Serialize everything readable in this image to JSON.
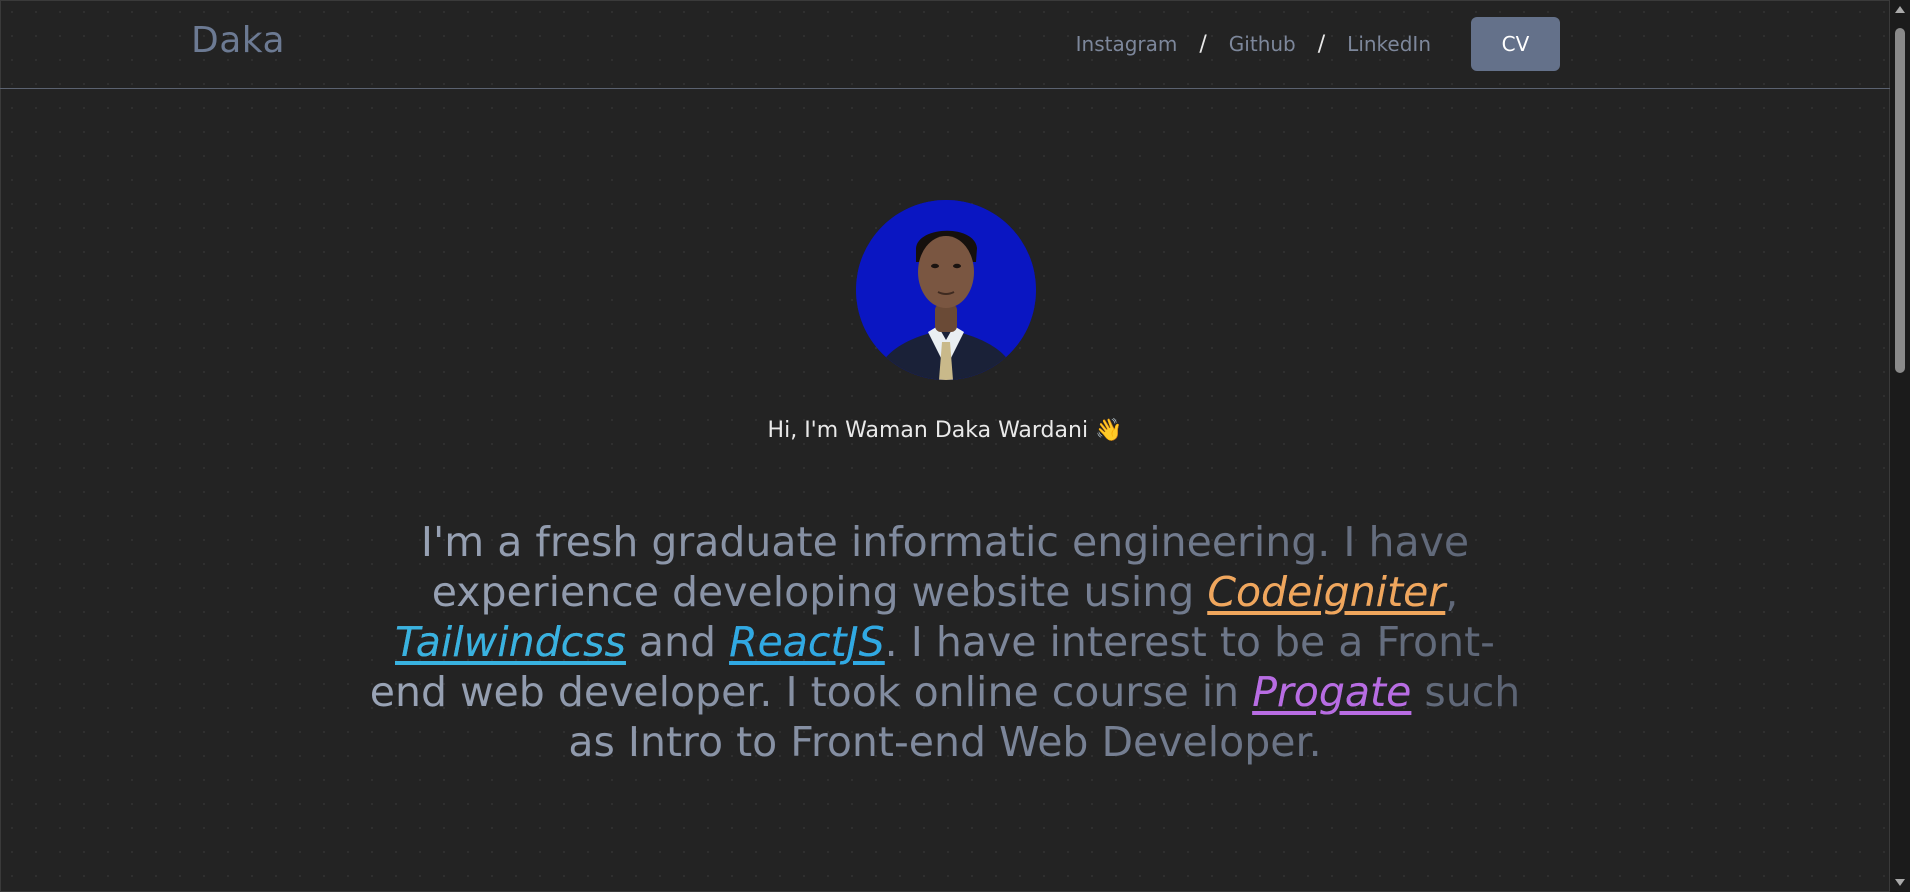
{
  "header": {
    "logo": "Daka",
    "nav": {
      "instagram": "Instagram",
      "separator": "/",
      "github": "Github",
      "linkedin": "LinkedIn",
      "cv": "CV"
    }
  },
  "hero": {
    "avatar_icon": "profile-photo",
    "greeting": "Hi, I'm Waman Daka Wardani 👋",
    "bio": {
      "t1": "I'm a fresh graduate informatic engineering. I have experience developing website using ",
      "codeigniter": "Codeigniter",
      "t2": ", ",
      "tailwind": "Tailwindcss",
      "t3": " and ",
      "react": "ReactJS",
      "t4": ". I have interest to be a Front-end web developer. I took online course in ",
      "progate": "Progate",
      "t5": " such as Intro to Front-end Web Developer."
    }
  },
  "colors": {
    "background": "#232323",
    "accent_button": "#64718a",
    "codeigniter": "#f0a65c",
    "tailwind": "#38b2e0",
    "react": "#2fa9e3",
    "progate": "#b86ce3",
    "avatar_bg": "#0a16c2"
  }
}
